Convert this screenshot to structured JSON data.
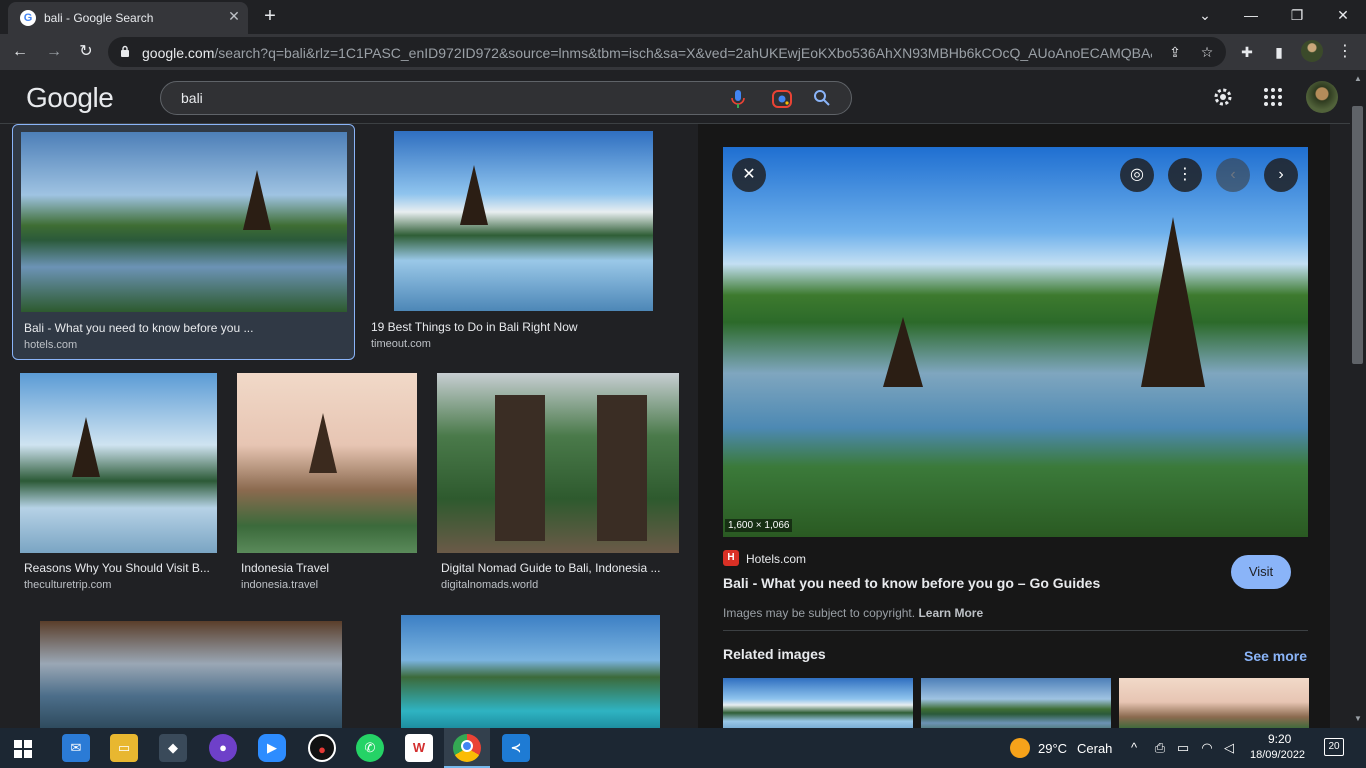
{
  "browser": {
    "tab_title": "bali - Google Search",
    "url_host": "google.com",
    "url_path": "/search?q=bali&rlz=1C1PASC_enID972ID972&source=lnms&tbm=isch&sa=X&ved=2ahUKEwjEoKXbo536AhXN93MBHb6kCOcQ_AUoAnoECAMQBA&..."
  },
  "google": {
    "logo": "Google",
    "search_value": "bali"
  },
  "results": [
    {
      "title": "Bali - What you need to know before you ...",
      "source": "hotels.com"
    },
    {
      "title": "19 Best Things to Do in Bali Right Now",
      "source": "timeout.com"
    },
    {
      "title": "Reasons Why You Should Visit B...",
      "source": "theculturetrip.com"
    },
    {
      "title": "Indonesia Travel",
      "source": "indonesia.travel"
    },
    {
      "title": "Digital Nomad Guide to Bali, Indonesia ...",
      "source": "digitalnomads.world"
    }
  ],
  "preview": {
    "dimensions": "1,600 × 1,066",
    "source_name": "Hotels.com",
    "title": "Bali - What you need to know before you go – Go Guides",
    "visit_label": "Visit",
    "copyright": "Images may be subject to copyright.",
    "learn_more": "Learn More",
    "related_title": "Related images",
    "see_more": "See more"
  },
  "taskbar": {
    "weather_temp": "29°C",
    "weather_cond": "Cerah",
    "time": "9:20",
    "date": "18/09/2022",
    "notifications": "20"
  },
  "colors": {
    "accent": "#8ab4f8",
    "background": "#202124",
    "preview_bg": "#171717"
  }
}
